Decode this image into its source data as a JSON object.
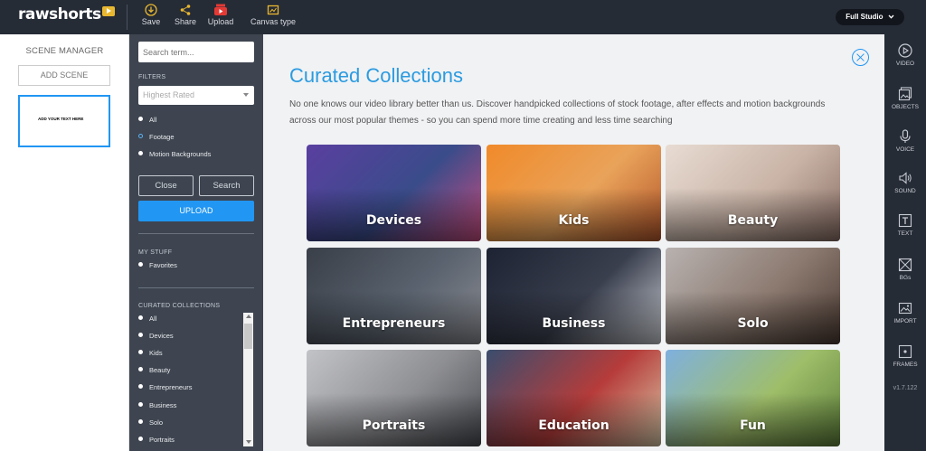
{
  "app": {
    "logo_text": "rawshorts",
    "studio_label": "Full Studio"
  },
  "toolbar": {
    "save": "Save",
    "share": "Share",
    "upload": "Upload",
    "canvas_type": "Canvas type"
  },
  "scene_manager": {
    "title": "SCENE MANAGER",
    "add_scene": "ADD SCENE",
    "thumbnail_text": "ADD YOUR TEXT HERE"
  },
  "media_panel": {
    "search_placeholder": "Search term...",
    "filters_label": "FILTERS",
    "sort_selected": "Highest Rated",
    "media_types": [
      "All",
      "Footage",
      "Motion Backgrounds"
    ],
    "selected_media_type": "Footage",
    "close_button": "Close",
    "search_button": "Search",
    "upload_button": "UPLOAD",
    "my_stuff_label": "MY STUFF",
    "favorites": "Favorites",
    "curated_label": "CURATED COLLECTIONS",
    "curated_items": [
      "All",
      "Devices",
      "Kids",
      "Beauty",
      "Entrepreneurs",
      "Business",
      "Solo",
      "Portraits"
    ]
  },
  "main": {
    "title": "Curated Collections",
    "description": "No one knows our video library better than us. Discover handpicked collections of stock footage, after effects and motion backgrounds across our most popular themes - so you can spend more time creating and less time searching",
    "collections": [
      {
        "label": "Devices",
        "colors": [
          "#5a3fa0",
          "#3a4c8a",
          "#c84d7f"
        ]
      },
      {
        "label": "Kids",
        "colors": [
          "#f08a2a",
          "#e9a35a",
          "#b5572b"
        ]
      },
      {
        "label": "Beauty",
        "colors": [
          "#e8dcd3",
          "#c9b3a6",
          "#8a6f66"
        ]
      },
      {
        "label": "Entrepreneurs",
        "colors": [
          "#3a3f48",
          "#59626e",
          "#8b8c92"
        ]
      },
      {
        "label": "Business",
        "colors": [
          "#1e2333",
          "#3a3f4e",
          "#c9ccd2"
        ]
      },
      {
        "label": "Solo",
        "colors": [
          "#b8b2b0",
          "#8c7a70",
          "#4a3a32"
        ]
      },
      {
        "label": "Portraits",
        "colors": [
          "#c2c3c7",
          "#8e8f93",
          "#4a4c52"
        ]
      },
      {
        "label": "Education",
        "colors": [
          "#3a4d6e",
          "#b63c3a",
          "#d9c9a8"
        ]
      },
      {
        "label": "Fun",
        "colors": [
          "#7fb0de",
          "#9fbe6a",
          "#5d7f3a"
        ]
      }
    ]
  },
  "right_toolbar": {
    "items": [
      "VIDEO",
      "OBJECTS",
      "VOICE",
      "SOUND",
      "TEXT",
      "BGs",
      "IMPORT",
      "FRAMES"
    ],
    "version": "v1.7.122"
  }
}
